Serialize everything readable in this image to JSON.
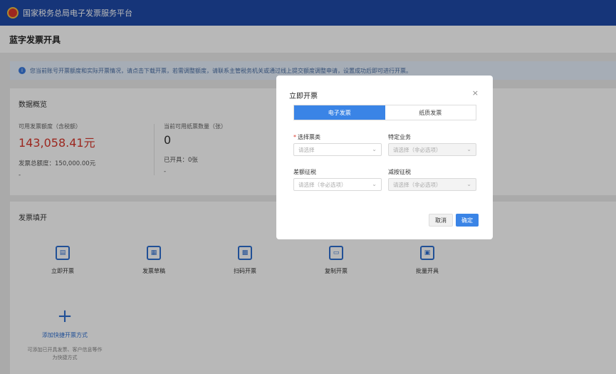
{
  "header": {
    "title": "国家税务总局电子发票服务平台"
  },
  "page": {
    "title": "蓝字发票开具"
  },
  "notice": {
    "text": "您当前账号开票额度和实际开票情况，请点击下载开票，若需调整额度，请联系主管税务机关或通过线上提交额度调整申请，设置成功后即可进行开票。"
  },
  "overview": {
    "title": "数据概览",
    "stats": [
      {
        "label": "可用发票额度（含税额）",
        "value": "143,058.41元",
        "sub": "发票总额度：150,000.00元",
        "dash": "-"
      },
      {
        "label": "当前可用纸票数量（张）",
        "value": "0",
        "sub": "已开具：0张",
        "dash": "-"
      }
    ]
  },
  "issue": {
    "title": "发票填开",
    "items": [
      {
        "label": "立即开票",
        "icon": "invoice-icon"
      },
      {
        "label": "发票草稿",
        "icon": "draft-icon"
      },
      {
        "label": "扫码开票",
        "icon": "qr-code-icon"
      },
      {
        "label": "复制开票",
        "icon": "copy-icon"
      },
      {
        "label": "批量开具",
        "icon": "batch-icon"
      }
    ],
    "add": {
      "label": "添加快捷开票方式",
      "desc": "可添加已开具发票、客户信息等作为快捷方式"
    }
  },
  "modal": {
    "title": "立即开票",
    "close": "×",
    "tabs": [
      "电子发票",
      "纸质发票"
    ],
    "fields": {
      "invoice_type": {
        "label": "选择票类",
        "placeholder": "请选择"
      },
      "special_business": {
        "label": "特定业务",
        "placeholder": "请选择（非必选项）"
      },
      "diff_tax": {
        "label": "差额征税",
        "placeholder": "请选择（非必选项）"
      },
      "reduced_tax": {
        "label": "减按征税",
        "placeholder": "请选择（非必选项）"
      }
    },
    "buttons": {
      "cancel": "取消",
      "ok": "确定"
    }
  }
}
